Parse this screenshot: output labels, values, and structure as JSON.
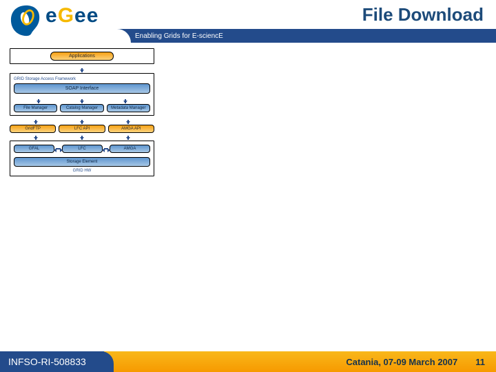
{
  "header": {
    "title": "File Download",
    "tagline": "Enabling Grids for E-sciencE",
    "logo_text_e1": "e",
    "logo_text_g": "G",
    "logo_text_e2": "e",
    "logo_text_e3": "e"
  },
  "diagram": {
    "applications": "Applications",
    "framework_label": "GRID Storage Access Framework",
    "soap": "SOAP Interface",
    "managers": [
      "File Manager",
      "Catalog Manager",
      "Metadata Manager"
    ],
    "apis": [
      "GridFTP",
      "LFC API",
      "AMGA API"
    ],
    "services": [
      "GFAL",
      "LFC",
      "AMGA"
    ],
    "storage": "Storage Element",
    "hw_label": "GRID HW"
  },
  "footer": {
    "left": "INFSO-RI-508833",
    "venue": "Catania, 07-09 March 2007",
    "page": "11"
  }
}
